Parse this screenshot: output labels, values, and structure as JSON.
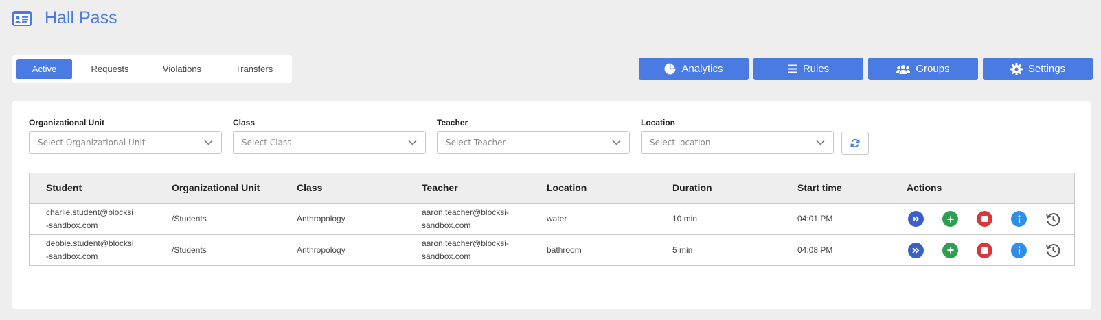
{
  "app": {
    "title": "Hall Pass",
    "icon": "id-card-icon",
    "accent": "#4a7be3"
  },
  "tabs": [
    {
      "label": "Active",
      "active": true
    },
    {
      "label": "Requests",
      "active": false
    },
    {
      "label": "Violations",
      "active": false
    },
    {
      "label": "Transfers",
      "active": false
    }
  ],
  "toolbar": {
    "analytics": {
      "label": "Analytics",
      "icon": "pie-chart-icon"
    },
    "rules": {
      "label": "Rules",
      "icon": "list-icon"
    },
    "groups": {
      "label": "Groups",
      "icon": "users-icon"
    },
    "settings": {
      "label": "Settings",
      "icon": "gear-icon"
    }
  },
  "filters": {
    "org_unit": {
      "label": "Organizational Unit",
      "placeholder": "Select Organizational Unit"
    },
    "class": {
      "label": "Class",
      "placeholder": "Select Class"
    },
    "teacher": {
      "label": "Teacher",
      "placeholder": "Select Teacher"
    },
    "location": {
      "label": "Location",
      "placeholder": "Select location"
    }
  },
  "table": {
    "headers": [
      "Student",
      "Organizational Unit",
      "Class",
      "Teacher",
      "Location",
      "Duration",
      "Start time",
      "Actions"
    ],
    "rows": [
      {
        "student": "charlie.student@blocksi-sandbox.com",
        "org_unit": "/Students",
        "class": "Anthropology",
        "teacher": "aaron.teacher@blocksi-sandbox.com",
        "location": "water",
        "duration": "10 min",
        "start_time": "04:01 PM"
      },
      {
        "student": "debbie.student@blocksi-sandbox.com",
        "org_unit": "/Students",
        "class": "Anthropology",
        "teacher": "aaron.teacher@blocksi-sandbox.com",
        "location": "bathroom",
        "duration": "5 min",
        "start_time": "04:08 PM"
      }
    ]
  },
  "action_colors": {
    "transfer": "#3b5fc9",
    "extend": "#2e9e4f",
    "end": "#d93838",
    "info": "#2f8fe6",
    "history": "#555555"
  }
}
